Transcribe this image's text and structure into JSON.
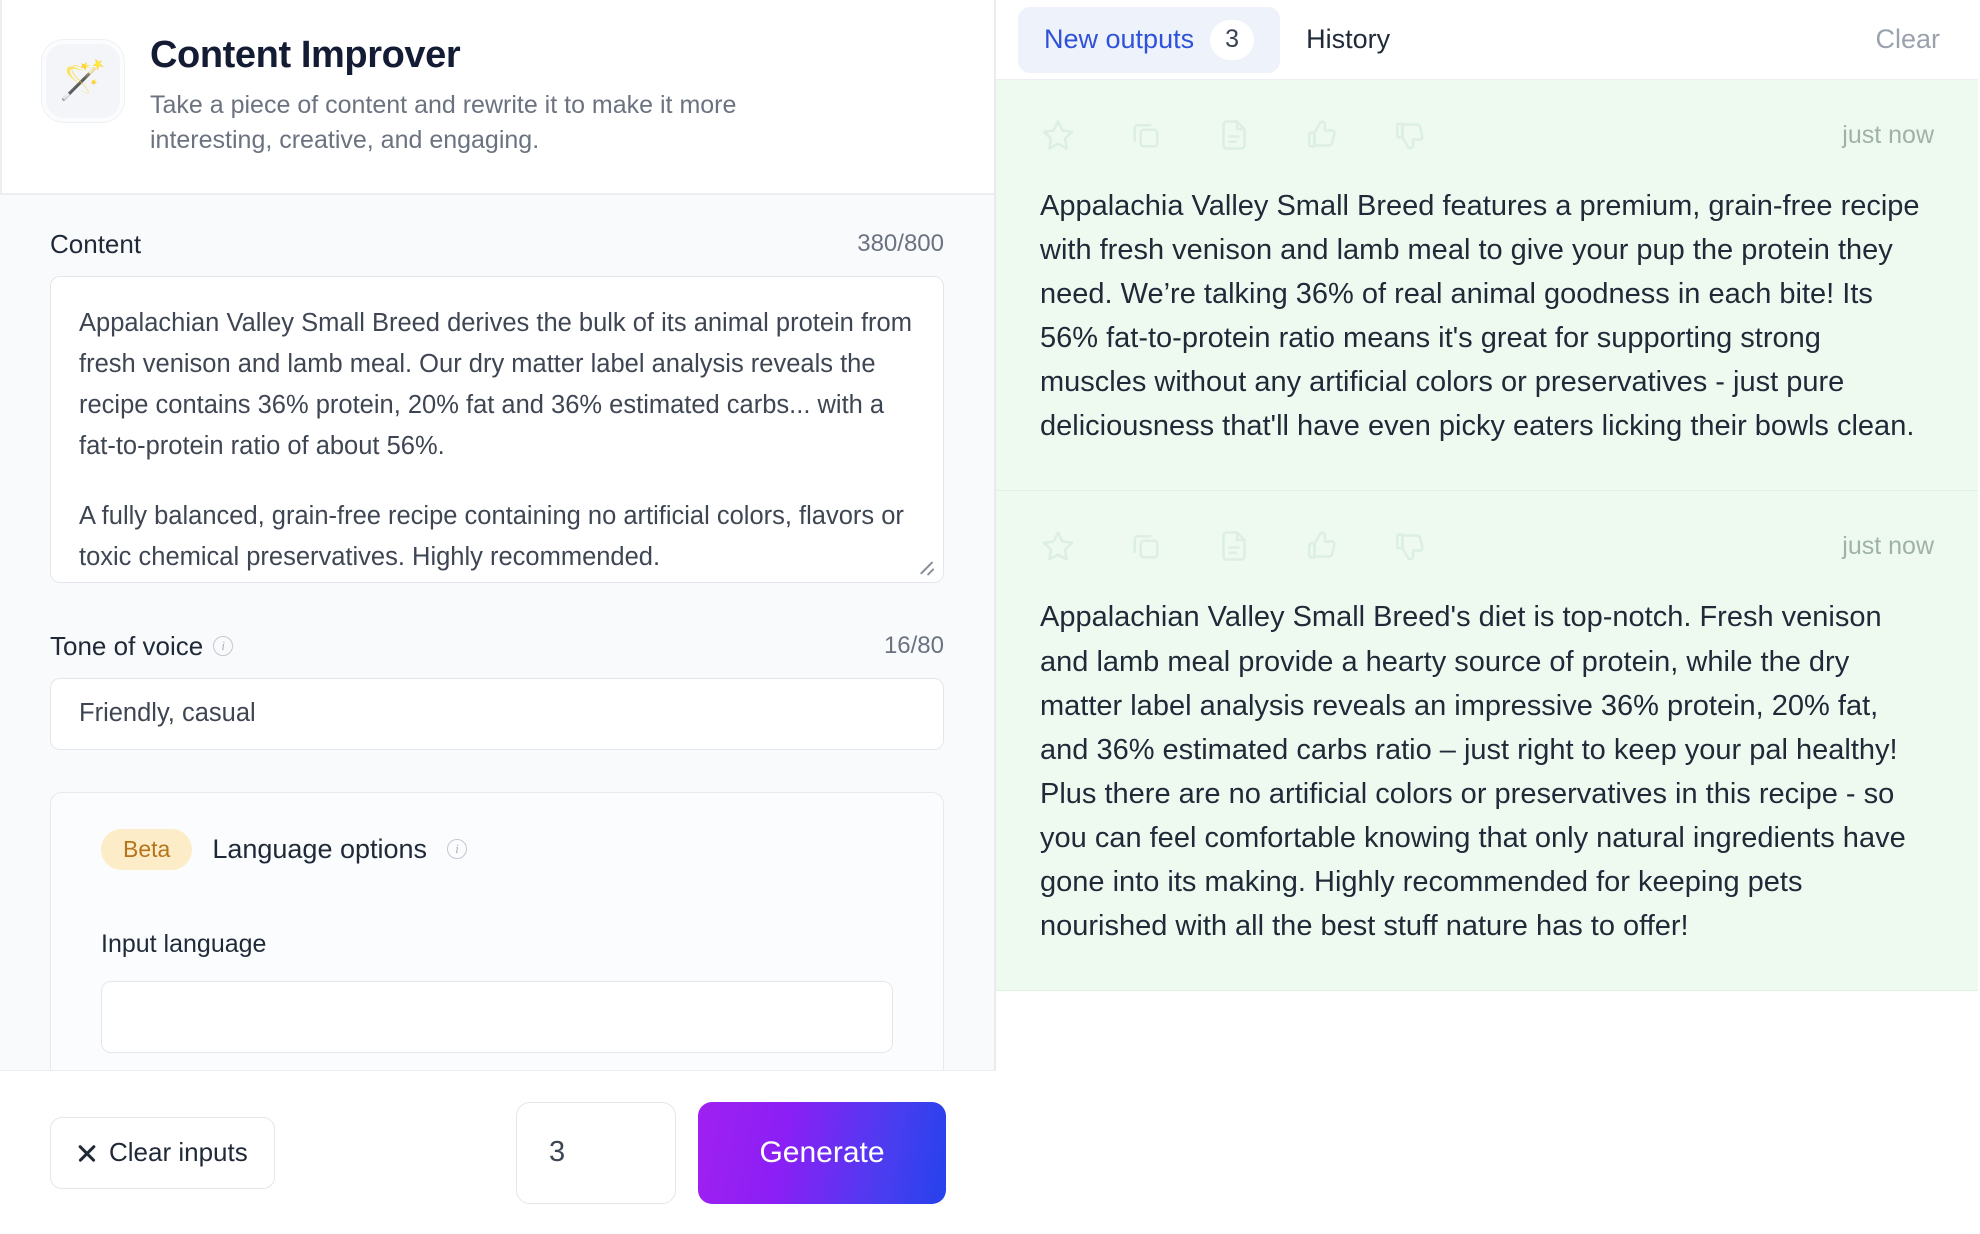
{
  "tool": {
    "icon": "magic-wand",
    "icon_glyph": "🪄",
    "title": "Content Improver",
    "description": "Take a piece of content and rewrite it to make it more interesting, creative, and engaging."
  },
  "form": {
    "content_field": {
      "label": "Content",
      "counter": "380/800",
      "paragraph_1": "Appalachian Valley Small Breed derives the bulk of its animal protein from fresh venison and lamb meal. Our dry matter label analysis reveals the recipe contains 36% protein, 20% fat and 36% estimated carbs... with a fat-to-protein ratio of about 56%.",
      "paragraph_2": "A fully balanced, grain-free recipe containing no artificial colors, flavors or toxic chemical preservatives. Highly recommended."
    },
    "tone_field": {
      "label": "Tone of voice",
      "info_icon": "info-icon",
      "counter": "16/80",
      "value": "Friendly, casual"
    },
    "language_options": {
      "badge": "Beta",
      "title": "Language options",
      "info_icon": "info-icon",
      "input_language_label": "Input language",
      "input_language_value": ""
    }
  },
  "footer": {
    "clear_inputs_label": "Clear inputs",
    "clear_icon": "close-x-icon",
    "output_count": "3",
    "generate_label": "Generate",
    "generate_gradient_from": "#a020f0",
    "generate_gradient_to": "#2442ec"
  },
  "outputs_panel": {
    "tab_new_label": "New outputs",
    "tab_new_count": "3",
    "tab_history_label": "History",
    "clear_label": "Clear",
    "accent_color": "#2f52d8",
    "card_background": "#eefaf0",
    "actions": [
      "favorite-star-icon",
      "copy-icon",
      "document-icon",
      "thumbs-up-icon",
      "thumbs-down-icon"
    ],
    "cards": [
      {
        "timestamp": "just now",
        "text": "Appalachia Valley Small Breed features a premium, grain-free recipe with fresh venison and lamb meal to give your pup the protein they need. We’re talking 36% of real animal goodness in each bite! Its 56% fat-to-protein ratio means it's great for supporting strong muscles without any artificial colors or preservatives - just pure deliciousness that'll have even picky eaters licking their bowls clean."
      },
      {
        "timestamp": "just now",
        "text": "Appalachian Valley Small Breed's diet is top-notch. Fresh venison and lamb meal provide a hearty source of protein, while the dry matter label analysis reveals an impressive 36% protein, 20% fat, and 36% estimated carbs ratio – just right to keep your pal healthy! Plus there are no artificial colors or preservatives in this recipe - so you can feel comfortable knowing that only natural ingredients have gone into its making. Highly recommended for keeping pets nourished with all the best stuff nature has to offer!"
      }
    ]
  }
}
